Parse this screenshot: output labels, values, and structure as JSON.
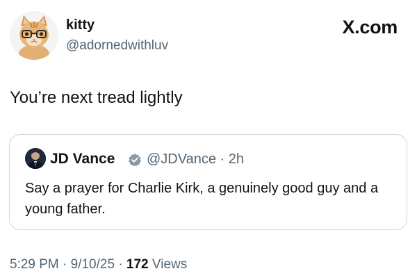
{
  "author": {
    "display_name": "kitty",
    "handle": "@adornedwithluv",
    "avatar_icon": "cat-with-glasses-avatar"
  },
  "brand": {
    "label": "X.com",
    "icon": "x-logo-icon"
  },
  "post": {
    "text": "You’re next tread lightly"
  },
  "quoted_post": {
    "display_name": "JD Vance",
    "verified_icon": "verified-badge-icon",
    "handle_meta": "@JDVance · 2h",
    "text": "Say a prayer for Charlie Kirk, a genuinely good guy and a young father."
  },
  "footer": {
    "time_date": "5:29 PM · 9/10/25 · ",
    "views_count": "172",
    "views_label": " Views"
  },
  "colors": {
    "text_primary": "#0f1419",
    "text_secondary": "#536471",
    "border": "#cfd9de",
    "verified_gray": "#8b98a5"
  }
}
